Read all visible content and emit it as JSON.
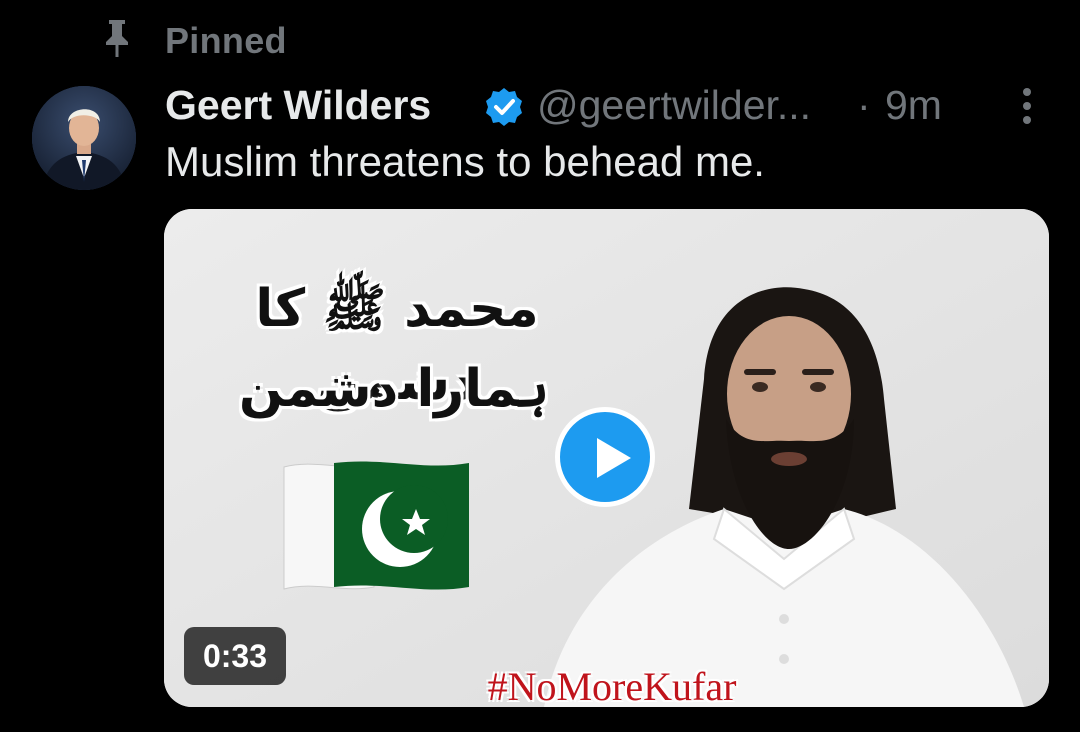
{
  "pinned": {
    "label": "Pinned",
    "icon": "pin-icon"
  },
  "tweet": {
    "author": {
      "display_name": "Geert Wilders",
      "handle": "@geertwilder...",
      "verified": true,
      "verified_color": "#1d9bf0"
    },
    "separator": "·",
    "time": "9m",
    "text": "Muslim threatens to behead me.",
    "more_icon": "more-vertical-icon"
  },
  "media": {
    "type": "video",
    "duration": "0:33",
    "overlay_text": {
      "urdu_line1": "محمد ﷺ کا دشمن",
      "urdu_line2": "ہمارا دشمن",
      "hashtag": "#NoMoreKufar"
    },
    "hashtag_color": "#c0141c",
    "play_button_color": "#1d9bf0"
  },
  "colors": {
    "background": "#000000",
    "text_primary": "#e7e9ea",
    "text_secondary": "#71767b"
  }
}
